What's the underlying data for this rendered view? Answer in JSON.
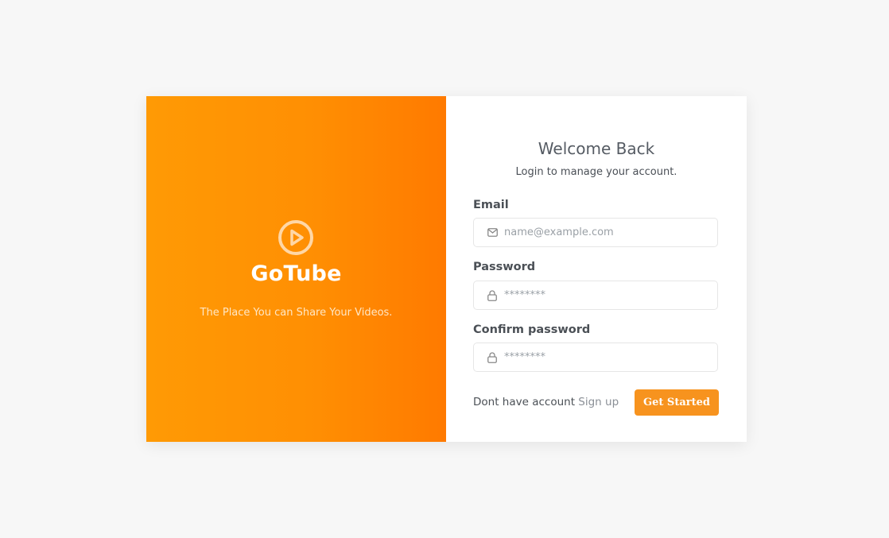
{
  "brand": {
    "name": "GoTube",
    "tagline": "The Place You can Share Your Videos.",
    "logo_icon": "play-circle-icon",
    "accent_color": "#ff8f03"
  },
  "form": {
    "title": "Welcome Back",
    "subtitle": "Login to manage your account.",
    "fields": [
      {
        "label": "Email",
        "icon": "mail-icon",
        "value": "",
        "placeholder": "name@example.com"
      },
      {
        "label": "Password",
        "icon": "lock-icon",
        "value": "",
        "placeholder": "********"
      },
      {
        "label": "Confirm password",
        "icon": "lock-icon",
        "value": "",
        "placeholder": "********"
      }
    ],
    "footer_text": "Dont have account",
    "signup_link": "Sign up",
    "submit_label": "Get Started",
    "button_color": "#f7931e"
  }
}
